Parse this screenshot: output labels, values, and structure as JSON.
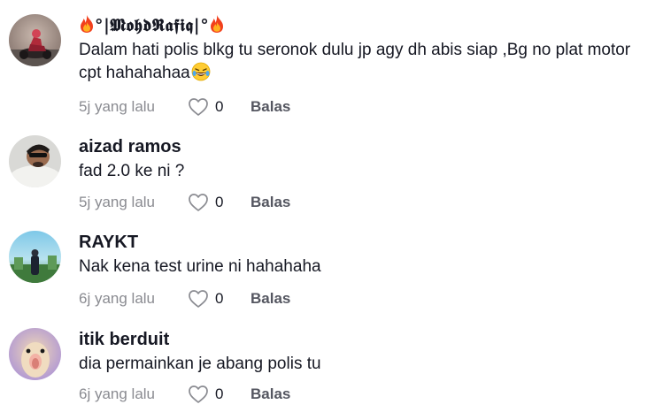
{
  "comments": [
    {
      "username": "°|𝕸𝖔𝖍𝖉𝕽𝖆𝖋𝖎𝖖|°",
      "text": "Dalam hati polis blkg tu seronok dulu jp agy dh abis siap ,Bg no plat motor cpt hahahahaa",
      "username_icons": [
        "fire-emoji",
        "fire-emoji"
      ],
      "text_emoji": "laughing-tears-emoji",
      "time": "5j yang lalu",
      "likes": "0",
      "reply_label": "Balas"
    },
    {
      "username": "aizad ramos",
      "text": "fad 2.0 ke ni ?",
      "time": "5j yang lalu",
      "likes": "0",
      "reply_label": "Balas"
    },
    {
      "username": "RAYKT",
      "text": "Nak kena test urine ni hahahaha",
      "time": "6j yang lalu",
      "likes": "0",
      "reply_label": "Balas"
    },
    {
      "username": "itik berduit",
      "text": "dia permainkan je abang polis tu",
      "time": "6j yang lalu",
      "likes": "0",
      "reply_label": "Balas"
    }
  ],
  "icons": {
    "like": "heart-outline-icon"
  },
  "colors": {
    "primary_text": "#161823",
    "secondary_text": "#8a8b91",
    "reply_text": "#545660",
    "background": "#ffffff"
  }
}
